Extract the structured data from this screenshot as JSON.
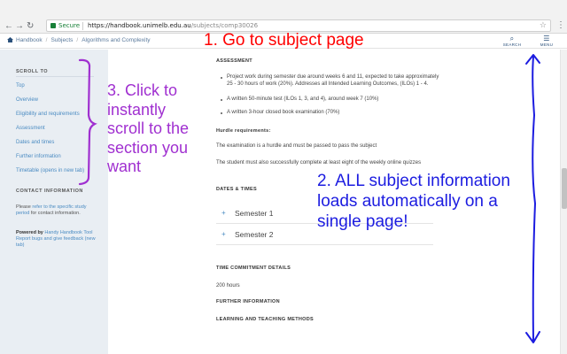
{
  "browser": {
    "secure_label": "Secure",
    "url_host": "https://handbook.unimelb.edu.au",
    "url_path": "/subjects/comp30026",
    "back_icon": "←",
    "forward_icon": "→",
    "reload_icon": "↻",
    "star_icon": "☆",
    "menu_icon": "⋮"
  },
  "site": {
    "breadcrumb": [
      "Handbook",
      "Subjects",
      "Algorithms and Complexity"
    ],
    "breadcrumb_sep": "/",
    "search_label": "SEARCH",
    "menu_label": "MENU",
    "search_icon": "⌕",
    "menu_icon": "☰"
  },
  "sidebar": {
    "scroll_title": "SCROLL TO",
    "links": [
      "Top",
      "Overview",
      "Eligibility and requirements",
      "Assessment",
      "Dates and times",
      "Further information",
      "Timetable (opens in new tab)"
    ],
    "contact_title": "CONTACT INFORMATION",
    "contact_pre": "Please ",
    "contact_link": "refer to the specific study period",
    "contact_post": " for contact information.",
    "powered_pre": "Powered by ",
    "powered_link": "Handy Handbook Tool",
    "report_link": "Report bugs and give feedback (new tab)"
  },
  "main": {
    "assessment_title": "ASSESSMENT",
    "assessment_items": [
      "Project work during semester due around weeks 6 and 11, expected to take approximately 25 - 30 hours of work (20%). Addresses all Intended Learning Outcomes, (ILOs) 1 - 4.",
      "A written 50-minute test (ILOs 1, 3, and 4), around week 7 (10%)",
      "A written 3-hour closed book examination (70%)"
    ],
    "hurdle_title": "Hurdle requirements:",
    "hurdle_text_1": "The examination is a hurdle and must be passed to pass the subject",
    "hurdle_text_2": "The student must also successfully complete at least eight of the weekly online quizzes",
    "dates_title": "DATES & TIMES",
    "semesters": [
      "Semester 1",
      "Semester 2"
    ],
    "plus_icon": "+",
    "time_title": "TIME COMMITMENT DETAILS",
    "time_value": "200 hours",
    "further_title": "FURTHER INFORMATION",
    "learning_title": "LEARNING AND TEACHING METHODS"
  },
  "annotations": {
    "step1": "1. Go to subject page",
    "step2_lines": [
      "2. ALL subject information",
      "loads automatically on a",
      "single page!"
    ],
    "step3_lines": [
      "3. Click to",
      "instantly",
      "scroll to the",
      "section you",
      "want"
    ]
  },
  "colors": {
    "step1": "#ff0000",
    "step2": "#1c1ce0",
    "step3": "#a030d0",
    "link": "#4a8bc2",
    "sidebar_bg": "#e9eef3"
  }
}
